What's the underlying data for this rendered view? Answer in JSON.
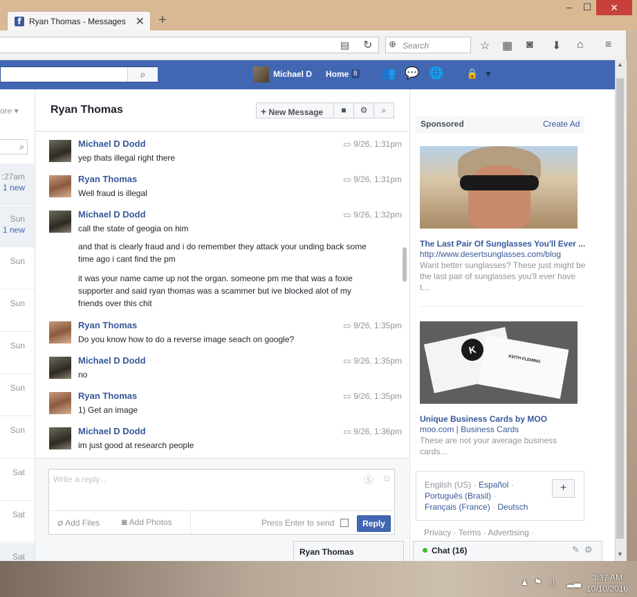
{
  "browser": {
    "tab_title": "Ryan Thomas - Messages",
    "tab_icon": "f",
    "search_placeholder": "Search"
  },
  "fb_header": {
    "profile_name": "Michael D",
    "home_label": "Home",
    "home_count": "8"
  },
  "left_panel": {
    "more_label": "ore ▾",
    "items": [
      {
        "time": ":27am",
        "new": "1 new"
      },
      {
        "time": "Sun",
        "new": "1 new"
      },
      {
        "time": "Sun",
        "new": ""
      },
      {
        "time": "Sun",
        "new": ""
      },
      {
        "time": "Sun",
        "new": ""
      },
      {
        "time": "Sun",
        "new": ""
      },
      {
        "time": "Sun",
        "new": ""
      },
      {
        "time": "Sat",
        "new": ""
      },
      {
        "time": "Sat",
        "new": ""
      },
      {
        "time": "Sat",
        "new": ""
      }
    ]
  },
  "conversation": {
    "title": "Ryan Thomas",
    "new_message_label": "New Message",
    "messages": [
      {
        "sender": "Michael D Dodd",
        "time": "9/26, 1:31pm",
        "body": "yep thats illegal right there"
      },
      {
        "sender": "Ryan Thomas",
        "time": "9/26, 1:31pm",
        "body": "Well fraud is illegal"
      },
      {
        "sender": "Michael D Dodd",
        "time": "9/26, 1:32pm",
        "body": "call the state of geogia on him"
      },
      {
        "sender": "",
        "time": "",
        "body": "and that is clearly fraud  and i do remember  they attack your unding back some time ago i cant find the pm"
      },
      {
        "sender": "",
        "time": "",
        "body": "it was your name came up  not the organ.   someone pm  me that was a foxie supporter and said ryan thomas was a scammer  but ive blocked alot of my friends over this chit"
      },
      {
        "sender": "Ryan Thomas",
        "time": "9/26, 1:35pm",
        "body": "Do you know how to do a reverse image seach on google?"
      },
      {
        "sender": "Michael D Dodd",
        "time": "9/26, 1:35pm",
        "body": "no"
      },
      {
        "sender": "Ryan Thomas",
        "time": "9/26, 1:35pm",
        "body": "1) Get an image"
      },
      {
        "sender": "Michael D Dodd",
        "time": "9/26, 1:36pm",
        "body": "im just good at research people"
      }
    ]
  },
  "composer": {
    "placeholder": "Write a reply...",
    "add_files": "Add Files",
    "add_photos": "Add Photos",
    "press_enter": "Press Enter to send",
    "reply_label": "Reply"
  },
  "chat_tab": {
    "name": "Ryan Thomas"
  },
  "sidebar": {
    "sponsored_label": "Sponsored",
    "create_ad": "Create Ad",
    "ads": [
      {
        "title": "The Last Pair Of Sunglasses You'll Ever ...",
        "url": "http://www.desertsunglasses.com/blog",
        "desc": "Want better sunglasses? These just might be the last pair of sunglasses you'll ever have t..."
      },
      {
        "title": "Unique Business Cards by MOO",
        "url": "moo.com | Business Cards",
        "desc": "These are not your average business cards...",
        "card_name": "KEITH FLEMING",
        "card_logo": "K"
      }
    ],
    "languages": {
      "current": "English (US)",
      "links": [
        "Español",
        "Português (Brasil)",
        "Français (France)",
        "Deutsch"
      ]
    },
    "footer": "Privacy · Terms · Advertising ·",
    "chat_label": "Chat (16)"
  },
  "system": {
    "time": "3:37 AM",
    "date": "10/10/2016"
  }
}
